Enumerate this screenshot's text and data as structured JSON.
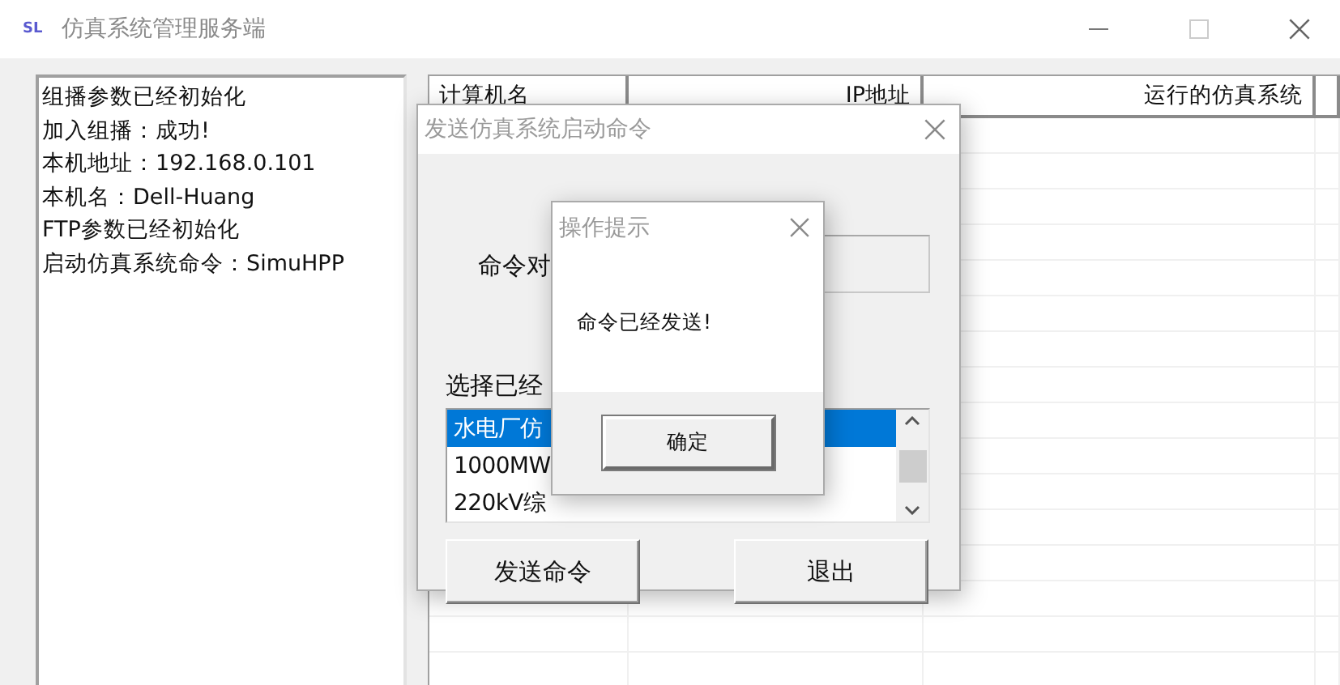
{
  "window": {
    "app_mark": "SL",
    "title": "仿真系统管理服务端"
  },
  "log": [
    "组播参数已经初始化",
    "加入组播：成功!",
    "本机地址：192.168.0.101",
    "本机名：Dell-Huang",
    "FTP参数已经初始化",
    "启动仿真系统命令：SimuHPP"
  ],
  "table": {
    "columns": [
      "计算机名",
      "IP地址",
      "运行的仿真系统"
    ]
  },
  "send_dialog": {
    "title": "发送仿真系统启动命令",
    "command_label": "命令对",
    "select_label": "选择已经",
    "systems": [
      {
        "label": "水电厂仿",
        "selected": true
      },
      {
        "label": "1000MW",
        "selected": false
      },
      {
        "label": "220kV综",
        "selected": false
      }
    ],
    "buttons": [
      "发送命令",
      "退出"
    ]
  },
  "alert": {
    "title": "操作提示",
    "message": "命令已经发送!",
    "button": "确定"
  }
}
